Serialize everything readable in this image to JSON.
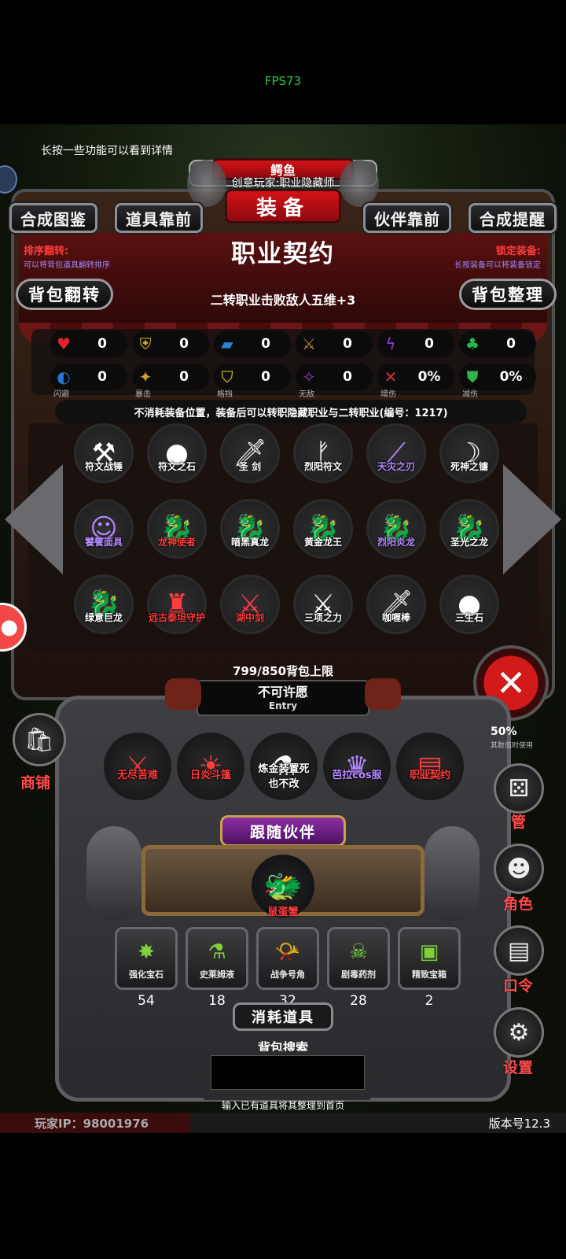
{
  "system": {
    "fps": "FPS73"
  },
  "hint": "长按一些功能可以看到详情",
  "header": {
    "small_title": "鳄鱼",
    "subtitle": "创意玩家:职业隐藏师",
    "title": "装备"
  },
  "top_tabs": [
    "合成图鉴",
    "道具靠前",
    "伙伴靠前",
    "合成提醒"
  ],
  "item_detail": {
    "title": "职业契约",
    "effect": "二转职业击败敌人五维+3",
    "description": "不消耗装备位置，装备后可以转职隐藏职业与二转职业(编号：1217)"
  },
  "sort": {
    "label": "排序翻转:",
    "desc": "可以将背包道具翻转排序",
    "button": "背包翻转"
  },
  "lock": {
    "label": "锁定装备:",
    "desc": "长按装备可以将装备锁定",
    "button": "背包整理"
  },
  "stats": [
    {
      "icon": "heart-icon",
      "glyph": "♥",
      "color": "#e0252b",
      "value": "0",
      "label": ""
    },
    {
      "icon": "armor-icon",
      "glyph": "⛨",
      "color": "#d8b21e",
      "value": "0",
      "label": ""
    },
    {
      "icon": "boot-icon",
      "glyph": "▰",
      "color": "#2b82d6",
      "value": "0",
      "label": ""
    },
    {
      "icon": "sword-icon",
      "glyph": "⚔",
      "color": "#b68a2b",
      "value": "0",
      "label": ""
    },
    {
      "icon": "lightning-icon",
      "glyph": "ϟ",
      "color": "#8b3ad0",
      "value": "0",
      "label": ""
    },
    {
      "icon": "clover-icon",
      "glyph": "♣",
      "color": "#2ab64a",
      "value": "0",
      "label": ""
    },
    {
      "icon": "dodge-icon",
      "glyph": "◐",
      "color": "#2a76d8",
      "value": "0",
      "label": "闪避"
    },
    {
      "icon": "crit-icon",
      "glyph": "✦",
      "color": "#c9a229",
      "value": "0",
      "label": "暴击"
    },
    {
      "icon": "block-icon",
      "glyph": "⛉",
      "color": "#e8d91d",
      "value": "0",
      "label": "格挡"
    },
    {
      "icon": "invincible-icon",
      "glyph": "✧",
      "color": "#9b3cd2",
      "value": "0",
      "label": "无敌"
    },
    {
      "icon": "damage-up-icon",
      "glyph": "✕",
      "color": "#d13036",
      "value": "0%",
      "label": "增伤"
    },
    {
      "icon": "damage-down-icon",
      "glyph": "⛊",
      "color": "#2fb54a",
      "value": "0%",
      "label": "减伤"
    }
  ],
  "inventory": [
    {
      "name": "符文战锤",
      "color": "#ffffff",
      "glyph": "⚒",
      "icon": "rune-hammer-icon"
    },
    {
      "name": "符文之石",
      "color": "#ffffff",
      "glyph": "●",
      "icon": "rune-stone-icon"
    },
    {
      "name": "圣 剑",
      "color": "#ffffff",
      "glyph": "🗡",
      "icon": "holy-sword-icon"
    },
    {
      "name": "烈阳符文",
      "color": "#ffffff",
      "glyph": "ᚠ",
      "icon": "sun-rune-icon"
    },
    {
      "name": "天灾之刃",
      "color": "#b58aff",
      "glyph": "⟋",
      "icon": "scourge-blade-icon"
    },
    {
      "name": "死神之镰",
      "color": "#ffffff",
      "glyph": "☽",
      "icon": "death-scythe-icon"
    },
    {
      "name": "饕餮面具",
      "color": "#b58aff",
      "glyph": "☺",
      "icon": "glutton-mask-icon"
    },
    {
      "name": "龙神使者",
      "color": "#ff3b3b",
      "glyph": "🐉",
      "icon": "dragon-envoy-icon"
    },
    {
      "name": "暗黑真龙",
      "color": "#ffffff",
      "glyph": "🐉",
      "icon": "dark-dragon-icon"
    },
    {
      "name": "黄金龙王",
      "color": "#ffffff",
      "glyph": "🐉",
      "icon": "golden-dragon-icon"
    },
    {
      "name": "烈阳炎龙",
      "color": "#b58aff",
      "glyph": "🐉",
      "icon": "sun-flame-dragon-icon"
    },
    {
      "name": "圣光之龙",
      "color": "#ffffff",
      "glyph": "🐉",
      "icon": "holy-light-dragon-icon"
    },
    {
      "name": "绿意巨龙",
      "color": "#ffffff",
      "glyph": "🐉",
      "icon": "green-dragon-icon"
    },
    {
      "name": "远古泰坦守护",
      "color": "#ff3b3b",
      "glyph": "♜",
      "icon": "titan-guardian-icon"
    },
    {
      "name": "湖中剑",
      "color": "#ff3b3b",
      "glyph": "⚔",
      "icon": "lake-sword-icon"
    },
    {
      "name": "三项之力",
      "color": "#ffffff",
      "glyph": "⚔",
      "icon": "triforce-icon"
    },
    {
      "name": "咖喱棒",
      "color": "#ffffff",
      "glyph": "🗡",
      "icon": "curry-stick-icon"
    },
    {
      "name": "三生石",
      "color": "#ffffff",
      "glyph": "●",
      "icon": "three-life-stone-icon"
    }
  ],
  "capacity": "799/850背包上限",
  "wish": {
    "title": "不可许愿",
    "entry": "Entry",
    "items": [
      {
        "name": "无尽苦难",
        "color": "#ff3b3b",
        "glyph": "⚔",
        "icon": "endless-suffering-icon"
      },
      {
        "name": "日炎斗篷",
        "color": "#ff3b3b",
        "glyph": "☀",
        "icon": "sun-cloak-icon"
      },
      {
        "name": "炼金装置死也不改",
        "color": "#ffffff",
        "glyph": "⚗",
        "icon": "alchemy-device-icon"
      },
      {
        "name": "芭拉cos服",
        "color": "#b58aff",
        "glyph": "♛",
        "icon": "bala-costume-icon"
      },
      {
        "name": "职业契约",
        "color": "#ff3b3b",
        "glyph": "▤",
        "icon": "job-contract-icon"
      }
    ]
  },
  "partner": {
    "title": "跟随伙伴",
    "name": "鼠蛋蟹",
    "glyph": "🐲"
  },
  "consumables": {
    "title": "消耗道具",
    "items": [
      {
        "name": "强化宝石",
        "count": "54",
        "glyph": "✸",
        "icon": "enhance-gem-icon"
      },
      {
        "name": "史莱姆液",
        "count": "18",
        "glyph": "⚗",
        "icon": "slime-liquid-icon"
      },
      {
        "name": "战争号角",
        "count": "32",
        "glyph": "📯",
        "icon": "war-horn-icon"
      },
      {
        "name": "剧毒药剂",
        "count": "28",
        "glyph": "☠",
        "icon": "poison-potion-icon"
      },
      {
        "name": "精致宝箱",
        "count": "2",
        "glyph": "▣",
        "icon": "treasure-chest-icon"
      }
    ]
  },
  "search": {
    "title": "背包搜索",
    "value": "",
    "hint": "输入已有道具将其整理到首页"
  },
  "footer": {
    "ip": "玩家IP：98001976",
    "version": "版本号12.3"
  },
  "side": {
    "shop": "商铺",
    "dice_pct": "50%",
    "dice_note": "其数值时使用",
    "manage": "管",
    "role": "角色",
    "code": "口令",
    "settings": "设置"
  }
}
